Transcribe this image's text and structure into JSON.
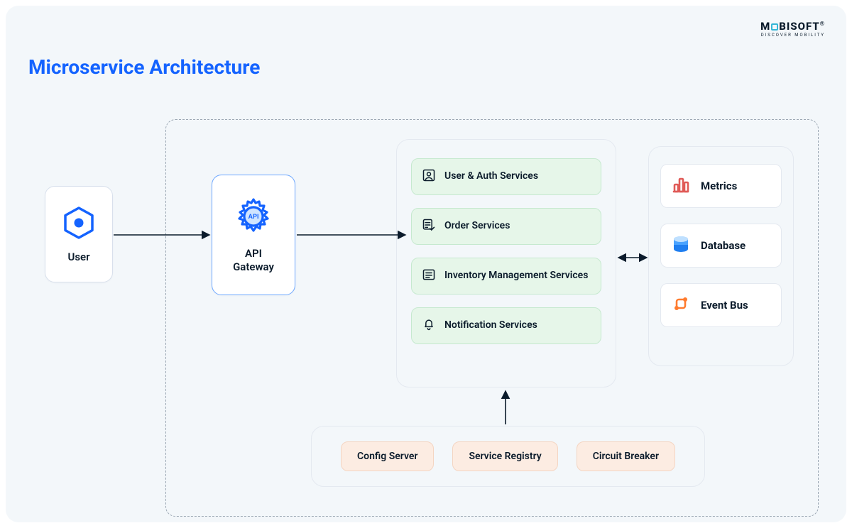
{
  "title": "Microservice Architecture",
  "logo": {
    "prefix": "M",
    "suffix": "BISOFT",
    "tagline": "DISCOVER MOBILITY"
  },
  "nodes": {
    "user": "User",
    "api_gateway_line1": "API",
    "api_gateway_line2": "Gateway"
  },
  "services": [
    {
      "label": "User & Auth Services"
    },
    {
      "label": "Order Services"
    },
    {
      "label": "Inventory Management Services"
    },
    {
      "label": "Notification Services"
    }
  ],
  "infra": [
    {
      "label": "Metrics"
    },
    {
      "label": "Database"
    },
    {
      "label": "Event Bus"
    }
  ],
  "support": [
    {
      "label": "Config Server"
    },
    {
      "label": "Service Registry"
    },
    {
      "label": "Circuit Breaker"
    }
  ],
  "colors": {
    "title": "#1463ff",
    "service_bg": "#e6f6e9",
    "support_bg": "#fcece2"
  }
}
